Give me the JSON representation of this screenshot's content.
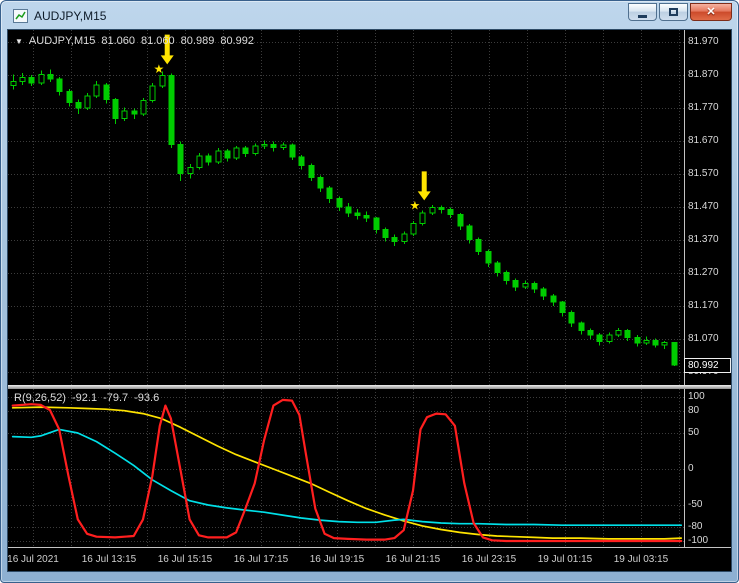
{
  "window": {
    "title": "AUDJPY,M15"
  },
  "chart": {
    "legend": {
      "dropdown_icon": "▼",
      "symbol": "AUDJPY,M15",
      "open": "81.060",
      "high": "81.060",
      "low": "80.989",
      "close": "80.992"
    },
    "price_axis": [
      "81.970",
      "81.870",
      "81.770",
      "81.670",
      "81.570",
      "81.470",
      "81.370",
      "81.270",
      "81.170",
      "81.070",
      "80.970"
    ],
    "current_price": "80.992",
    "time_axis": [
      "16 Jul 2021",
      "16 Jul 13:15",
      "16 Jul 15:15",
      "16 Jul 17:15",
      "16 Jul 19:15",
      "16 Jul 21:15",
      "16 Jul 23:15",
      "19 Jul 01:15",
      "19 Jul 03:15"
    ]
  },
  "indicator": {
    "legend": {
      "name": "R(9,26,52)",
      "values": [
        "-92.1",
        "-79.7",
        "-93.6"
      ]
    },
    "axis": [
      "100",
      "80",
      "50",
      "0",
      "-50",
      "-80",
      "-100"
    ]
  },
  "colors": {
    "background": "#000000",
    "grid": "#3c3c3c",
    "candle": "#00cc00",
    "candle_fill_up": "#000000",
    "candle_fill_down": "#00cc00",
    "signal": "#ffe400",
    "axis_text": "#dadada"
  },
  "chart_data": {
    "type": "candlestick",
    "symbol": "AUDJPY",
    "timeframe": "M15",
    "ylim": [
      80.931,
      82.006
    ],
    "price_grid_step": 0.1,
    "candles": [
      [
        81.838,
        81.872,
        81.826,
        81.85
      ],
      [
        81.85,
        81.876,
        81.84,
        81.862
      ],
      [
        81.862,
        81.87,
        81.836,
        81.845
      ],
      [
        81.845,
        81.884,
        81.84,
        81.872
      ],
      [
        81.872,
        81.886,
        81.848,
        81.858
      ],
      [
        81.858,
        81.864,
        81.808,
        81.82
      ],
      [
        81.82,
        81.828,
        81.774,
        81.786
      ],
      [
        81.786,
        81.795,
        81.752,
        81.77
      ],
      [
        81.77,
        81.815,
        81.764,
        81.806
      ],
      [
        81.806,
        81.852,
        81.8,
        81.84
      ],
      [
        81.84,
        81.846,
        81.784,
        81.795
      ],
      [
        81.795,
        81.8,
        81.722,
        81.738
      ],
      [
        81.738,
        81.772,
        81.73,
        81.76
      ],
      [
        81.76,
        81.768,
        81.736,
        81.752
      ],
      [
        81.752,
        81.8,
        81.746,
        81.792
      ],
      [
        81.792,
        81.845,
        81.786,
        81.836
      ],
      [
        81.836,
        81.88,
        81.83,
        81.868
      ],
      [
        81.868,
        81.874,
        81.648,
        81.66
      ],
      [
        81.66,
        81.668,
        81.548,
        81.572
      ],
      [
        81.572,
        81.6,
        81.556,
        81.59
      ],
      [
        81.59,
        81.634,
        81.584,
        81.625
      ],
      [
        81.625,
        81.632,
        81.596,
        81.606
      ],
      [
        81.606,
        81.648,
        81.6,
        81.64
      ],
      [
        81.64,
        81.646,
        81.608,
        81.618
      ],
      [
        81.618,
        81.654,
        81.612,
        81.648
      ],
      [
        81.648,
        81.655,
        81.622,
        81.632
      ],
      [
        81.632,
        81.662,
        81.626,
        81.655
      ],
      [
        81.655,
        81.672,
        81.645,
        81.66
      ],
      [
        81.66,
        81.668,
        81.638,
        81.65
      ],
      [
        81.65,
        81.666,
        81.642,
        81.658
      ],
      [
        81.658,
        81.662,
        81.612,
        81.622
      ],
      [
        81.622,
        81.628,
        81.584,
        81.596
      ],
      [
        81.596,
        81.602,
        81.548,
        81.56
      ],
      [
        81.56,
        81.566,
        81.516,
        81.528
      ],
      [
        81.528,
        81.534,
        81.482,
        81.495
      ],
      [
        81.495,
        81.502,
        81.458,
        81.47
      ],
      [
        81.47,
        81.482,
        81.44,
        81.452
      ],
      [
        81.452,
        81.464,
        81.432,
        81.444
      ],
      [
        81.444,
        81.456,
        81.424,
        81.436
      ],
      [
        81.436,
        81.44,
        81.39,
        81.402
      ],
      [
        81.402,
        81.408,
        81.366,
        81.378
      ],
      [
        81.378,
        81.386,
        81.352,
        81.365
      ],
      [
        81.365,
        81.396,
        81.358,
        81.388
      ],
      [
        81.388,
        81.428,
        81.382,
        81.42
      ],
      [
        81.42,
        81.46,
        81.414,
        81.452
      ],
      [
        81.452,
        81.476,
        81.446,
        81.468
      ],
      [
        81.468,
        81.474,
        81.45,
        81.462
      ],
      [
        81.462,
        81.468,
        81.436,
        81.448
      ],
      [
        81.448,
        81.452,
        81.4,
        81.412
      ],
      [
        81.412,
        81.418,
        81.36,
        81.372
      ],
      [
        81.372,
        81.378,
        81.324,
        81.336
      ],
      [
        81.336,
        81.342,
        81.288,
        81.3
      ],
      [
        81.3,
        81.306,
        81.26,
        81.272
      ],
      [
        81.272,
        81.278,
        81.236,
        81.248
      ],
      [
        81.248,
        81.254,
        81.216,
        81.228
      ],
      [
        81.228,
        81.248,
        81.222,
        81.238
      ],
      [
        81.238,
        81.244,
        81.21,
        81.222
      ],
      [
        81.222,
        81.228,
        81.188,
        81.2
      ],
      [
        81.2,
        81.206,
        81.17,
        81.182
      ],
      [
        81.182,
        81.186,
        81.138,
        81.15
      ],
      [
        81.15,
        81.156,
        81.106,
        81.118
      ],
      [
        81.118,
        81.124,
        81.084,
        81.096
      ],
      [
        81.096,
        81.102,
        81.07,
        81.082
      ],
      [
        81.082,
        81.088,
        81.05,
        81.062
      ],
      [
        81.062,
        81.09,
        81.056,
        81.082
      ],
      [
        81.082,
        81.104,
        81.076,
        81.096
      ],
      [
        81.096,
        81.1,
        81.064,
        81.075
      ],
      [
        81.075,
        81.082,
        81.048,
        81.058
      ],
      [
        81.058,
        81.078,
        81.052,
        81.066
      ],
      [
        81.066,
        81.072,
        81.044,
        81.052
      ],
      [
        81.052,
        81.064,
        81.04,
        81.06
      ],
      [
        81.06,
        81.06,
        80.989,
        80.992
      ]
    ],
    "signals": [
      {
        "type": "sell",
        "star_i": 15.7,
        "star_price": 81.888,
        "arrow_i": 16.6,
        "arrow_from": 81.992,
        "arrow_to": 81.902
      },
      {
        "type": "sell",
        "star_i": 43.2,
        "star_price": 81.474,
        "arrow_i": 44.2,
        "arrow_from": 81.578,
        "arrow_to": 81.49
      }
    ],
    "indicator": {
      "name": "R(9,26,52)",
      "ylim": [
        -108.3,
        111.1
      ],
      "levels": [
        100,
        80,
        50,
        0,
        -50,
        -80,
        -100
      ],
      "series": [
        {
          "name": "yellow",
          "color": "#ffe400",
          "width": 1.7,
          "points": [
            [
              0,
              85
            ],
            [
              3,
              86
            ],
            [
              6,
              85
            ],
            [
              8,
              84
            ],
            [
              10,
              83
            ],
            [
              12,
              81
            ],
            [
              14,
              77
            ],
            [
              16,
              70
            ],
            [
              18,
              58
            ],
            [
              20,
              45
            ],
            [
              22,
              32
            ],
            [
              24,
              20
            ],
            [
              26,
              10
            ],
            [
              28,
              0
            ],
            [
              30,
              -10
            ],
            [
              32,
              -20
            ],
            [
              34,
              -32
            ],
            [
              36,
              -44
            ],
            [
              38,
              -55
            ],
            [
              40,
              -64
            ],
            [
              42,
              -72
            ],
            [
              44,
              -79
            ],
            [
              46,
              -84
            ],
            [
              48,
              -88
            ],
            [
              50,
              -91
            ],
            [
              52,
              -93
            ],
            [
              54,
              -94
            ],
            [
              56,
              -95
            ],
            [
              58,
              -96
            ],
            [
              61,
              -96
            ],
            [
              64,
              -97
            ],
            [
              67,
              -97
            ],
            [
              70,
              -97
            ],
            [
              71.8,
              -96
            ]
          ]
        },
        {
          "name": "cyan",
          "color": "#00e0e8",
          "width": 1.7,
          "points": [
            [
              0,
              45
            ],
            [
              2,
              44
            ],
            [
              3,
              46
            ],
            [
              5,
              55
            ],
            [
              7,
              50
            ],
            [
              9,
              38
            ],
            [
              11,
              22
            ],
            [
              13,
              5
            ],
            [
              15,
              -15
            ],
            [
              17,
              -30
            ],
            [
              19,
              -44
            ],
            [
              21,
              -50
            ],
            [
              23,
              -54
            ],
            [
              25,
              -57
            ],
            [
              27,
              -60
            ],
            [
              29,
              -64
            ],
            [
              31,
              -68
            ],
            [
              33,
              -71
            ],
            [
              35,
              -73
            ],
            [
              37,
              -74
            ],
            [
              39,
              -74
            ],
            [
              41,
              -71
            ],
            [
              42,
              -70
            ],
            [
              44,
              -73
            ],
            [
              46,
              -75
            ],
            [
              48,
              -76
            ],
            [
              50,
              -76
            ],
            [
              53,
              -77
            ],
            [
              56,
              -77
            ],
            [
              59,
              -78
            ],
            [
              62,
              -78
            ],
            [
              65,
              -78
            ],
            [
              68,
              -78
            ],
            [
              71.8,
              -78
            ]
          ]
        },
        {
          "name": "red",
          "color": "#ff1f1f",
          "width": 2.2,
          "points": [
            [
              0,
              88
            ],
            [
              2,
              90
            ],
            [
              3,
              89
            ],
            [
              4,
              82
            ],
            [
              5,
              55
            ],
            [
              6,
              -10
            ],
            [
              7,
              -70
            ],
            [
              8,
              -90
            ],
            [
              9,
              -94
            ],
            [
              11,
              -95
            ],
            [
              13,
              -93
            ],
            [
              14,
              -70
            ],
            [
              15,
              -10
            ],
            [
              15.8,
              60
            ],
            [
              16.4,
              88
            ],
            [
              17,
              70
            ],
            [
              18,
              0
            ],
            [
              19,
              -70
            ],
            [
              20,
              -92
            ],
            [
              21,
              -95
            ],
            [
              23,
              -95
            ],
            [
              24,
              -88
            ],
            [
              25,
              -55
            ],
            [
              26,
              -20
            ],
            [
              27,
              40
            ],
            [
              28,
              88
            ],
            [
              29,
              96
            ],
            [
              30,
              95
            ],
            [
              30.8,
              75
            ],
            [
              31.5,
              20
            ],
            [
              32.5,
              -55
            ],
            [
              33.5,
              -90
            ],
            [
              34.5,
              -96
            ],
            [
              36,
              -97
            ],
            [
              38,
              -98
            ],
            [
              40,
              -98
            ],
            [
              41,
              -96
            ],
            [
              42,
              -85
            ],
            [
              43,
              -30
            ],
            [
              43.8,
              55
            ],
            [
              44.5,
              72
            ],
            [
              45.5,
              77
            ],
            [
              46.5,
              76
            ],
            [
              47.5,
              60
            ],
            [
              48.5,
              -20
            ],
            [
              49.5,
              -75
            ],
            [
              50.5,
              -95
            ],
            [
              51.5,
              -99
            ],
            [
              53,
              -100
            ],
            [
              56,
              -100
            ],
            [
              59,
              -100
            ],
            [
              62,
              -100
            ],
            [
              65,
              -100
            ],
            [
              68,
              -100
            ],
            [
              71.8,
              -100
            ]
          ]
        }
      ]
    }
  }
}
